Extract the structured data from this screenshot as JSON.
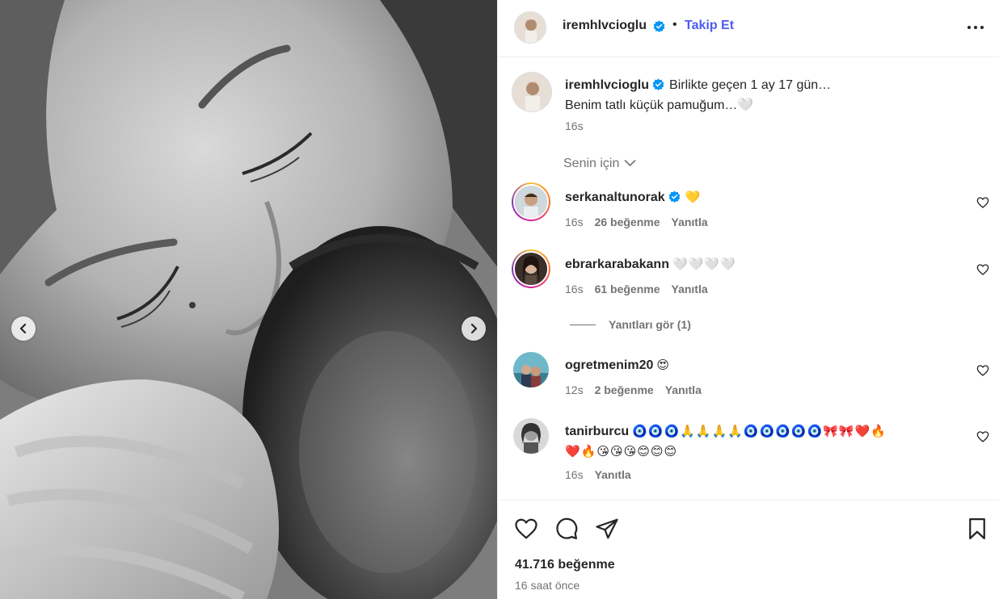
{
  "post": {
    "author": "iremhlvcioglu",
    "follow_label": "Takip Et",
    "separator": "•",
    "caption_line1": "Birlikte geçen 1 ay 17 gün…",
    "caption_line2": "Benim tatlı küçük pamuğum…🤍",
    "caption_time": "16s"
  },
  "filter_label": "Senin için",
  "comments": [
    {
      "username": "serkanaltunorak",
      "verified": true,
      "text": "💛",
      "time": "16s",
      "likes": "26 beğenme",
      "reply": "Yanıtla"
    },
    {
      "username": "ebrarkarabakann",
      "verified": false,
      "text": "🤍🤍🤍🤍",
      "time": "16s",
      "likes": "61 beğenme",
      "reply": "Yanıtla"
    },
    {
      "username": "ogretmenim20",
      "verified": false,
      "text": "😍",
      "time": "12s",
      "likes": "2 beğenme",
      "reply": "Yanıtla"
    },
    {
      "username": "tanirburcu",
      "verified": false,
      "text_line1": "🧿🧿🧿🙏🙏🙏🙏🧿🧿🧿🧿🧿🎀🎀❤️🔥",
      "text_line2": "❤️🔥😘😘😘😊😊😊",
      "time": "16s",
      "reply": "Yanıtla"
    }
  ],
  "view_replies": "Yanıtları gör (1)",
  "footer": {
    "likes": "41.716 beğenme",
    "posted": "16 saat önce"
  },
  "colors": {
    "accent": "#4d5cf0",
    "verified": "#0095f6",
    "text": "#262626",
    "muted": "#737373"
  },
  "icons": [
    "chevron-left-icon",
    "chevron-right-icon",
    "verified-badge-icon",
    "more-options-icon",
    "chevron-down-icon",
    "heart-icon",
    "comment-icon",
    "share-icon",
    "bookmark-icon"
  ]
}
